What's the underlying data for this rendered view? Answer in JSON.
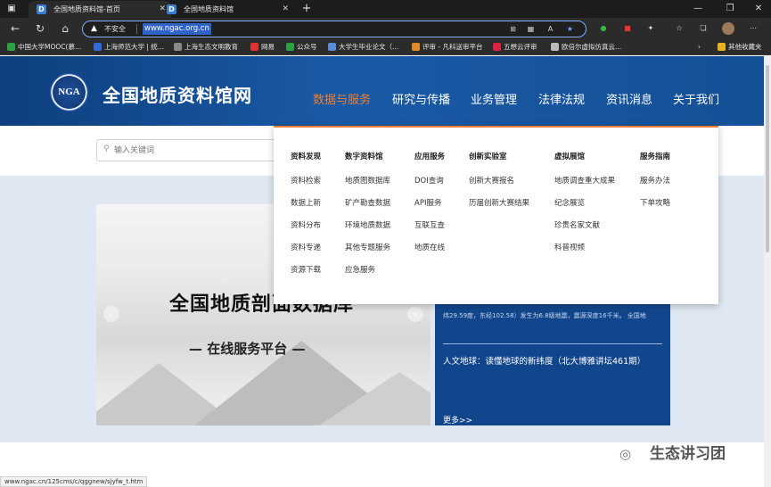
{
  "browser": {
    "tabs": [
      {
        "title": "全国地质资料馆-首页",
        "active": true
      },
      {
        "title": "全国地质资料馆",
        "active": false
      }
    ],
    "address": {
      "security_label": "不安全",
      "url": "www.ngac.org.cn"
    },
    "bookmarks": [
      {
        "label": "中国大学MOOC(慕...",
        "color": "#2ea043"
      },
      {
        "label": "上海师范大学 | 统...",
        "color": "#2e6bd6"
      },
      {
        "label": "上海生态文明教育",
        "color": "#8a8a8a"
      },
      {
        "label": "网易",
        "color": "#d33"
      },
      {
        "label": "公众号",
        "color": "#2ea043"
      },
      {
        "label": "大学生毕业论文（...",
        "color": "#5a8ad8"
      },
      {
        "label": "评审 - 凡科送审平台",
        "color": "#e08a2a"
      },
      {
        "label": "五想云评审",
        "color": "#d24"
      },
      {
        "label": "欧倍尔虚拟仿真云...",
        "color": "#bbb"
      },
      {
        "label": "其他收藏夹",
        "color": "#e6b422"
      }
    ],
    "status_url": "www.ngac.cn/125cms/c/qggnew/sjyfw_t.htm"
  },
  "site": {
    "logo_text": "NGA",
    "name": "全国地质资料馆网",
    "nav": [
      {
        "label": "数据与服务",
        "active": true
      },
      {
        "label": "研究与传播",
        "active": false
      },
      {
        "label": "业务管理",
        "active": false
      },
      {
        "label": "法律法规",
        "active": false
      },
      {
        "label": "资讯消息",
        "active": false
      },
      {
        "label": "关于我们",
        "active": false
      }
    ],
    "search_placeholder": "输入关键词"
  },
  "dropdown": {
    "columns": [
      {
        "heading": "资料发现",
        "items": [
          "资料检索",
          "数据上新",
          "资料分布",
          "资料专递",
          "资源下载"
        ]
      },
      {
        "heading": "数字资料馆",
        "items": [
          "地质图数据库",
          "矿产勘查数据",
          "环境地质数据",
          "其他专题服务",
          "应急服务"
        ]
      },
      {
        "heading": "应用服务",
        "items": [
          "DOI查询",
          "API服务",
          "互联互查",
          "地质在线"
        ]
      },
      {
        "heading": "创新实验室",
        "items": [
          "创新大赛报名",
          "历届创新大赛结果"
        ]
      },
      {
        "heading": "虚拟展馆",
        "items": [
          "地质调查重大成果",
          "纪念展览",
          "珍贵名家文献",
          "科普视频"
        ]
      },
      {
        "heading": "服务指南",
        "items": [
          "服务办法",
          "下单攻略"
        ]
      }
    ]
  },
  "banner": {
    "title": "全国地质剖面数据库",
    "subtitle": "— 在线服务平台 —",
    "prev_icon": "‹",
    "next_icon": "›"
  },
  "news": {
    "lines": [
      "纬29.59度，东经102.58）发生为6.8级地震，震源深度16千米。 全国地"
    ],
    "item": "人文地球：读懂地球的新纬度（北大博雅讲坛461期）",
    "more": "更多>>"
  },
  "watermark": "生态讲习团"
}
